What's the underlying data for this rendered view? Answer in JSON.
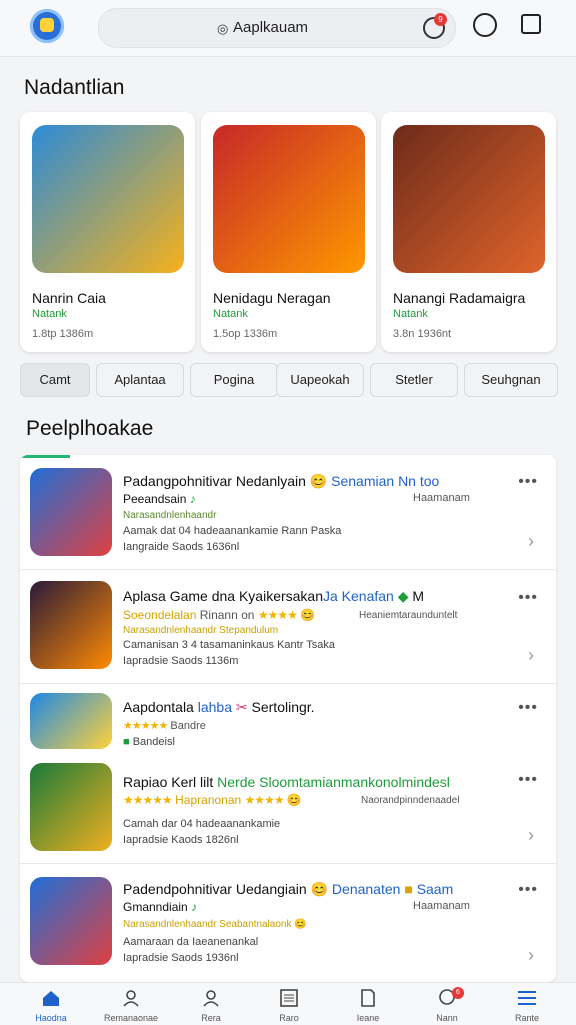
{
  "header": {
    "search_icon": "circle-dot-icon",
    "search_text": "Aaplkauam",
    "search_badge": "9"
  },
  "featured": {
    "title": "Nadantlian",
    "cards": [
      {
        "title": "Nanrin Caia",
        "sub": "Natank",
        "meta": "1.8tp 1386m",
        "colors": [
          "#2c8bd8",
          "#f7b11a"
        ]
      },
      {
        "title": "Nenidagu Neragan",
        "sub": "Natank",
        "meta": "1.5op 1336m",
        "colors": [
          "#c62828",
          "#ff9800"
        ]
      },
      {
        "title": "Nanangi Radamaigra",
        "sub": "Natank",
        "meta": "3.8n 1936nt",
        "colors": [
          "#6d2b1a",
          "#e0642b"
        ]
      }
    ]
  },
  "chips": [
    "Camt",
    "Aplantaa",
    "Pogina",
    "Uapeokah",
    "Stetler",
    "Seuhgnan"
  ],
  "popular": {
    "title": "Peelplhoakae",
    "rows": [
      {
        "title_a": "Padangpohnitivar Nedanlyain",
        "title_b": "Senamian Nn",
        "title_c": "too",
        "line2": "Peeandsain",
        "line2_right": "Haamanam",
        "line3": "Narasandnlenhaandr",
        "line4": "Aamak dat 04 hadeaanankamie Rann Paska",
        "line5": "Iangraide Saods 1636nl",
        "colors": [
          "#1f6fd6",
          "#e04040"
        ]
      },
      {
        "title_a": "Aplasa Game dna Kyaikersakan",
        "title_b": "Ja Kenafan",
        "title_c": "M",
        "line2": "Soeondelalan",
        "line2_mid": "Rinann on",
        "line2_right": "Heaniemtaraunduntelt",
        "line3": "Narasandnlenhaandr Stepandulum",
        "line4": "Camanisan 3 4 tasamaninkaus Kantr Tsaka",
        "line5": "Iapradsie Saods 1136m",
        "colors": [
          "#2a1a3a",
          "#ff8a00"
        ]
      },
      {
        "title_a": "Aapdontala",
        "title_b": "lahba",
        "title_c": "Sertolingr.",
        "line2": "★★★★★",
        "line2_right": "Bandre",
        "line3": "Bandeisl",
        "colors": [
          "#1e88e5",
          "#ffd23a"
        ]
      },
      {
        "title_a": "Rapiao Kerl lilt",
        "title_b": "Nerde Sloomtamianmankonolmindesl",
        "line2": "★★★★★",
        "line2_mid": "Hapranonan",
        "line2_right": "Naorandpinndenaadel",
        "line4": "Camah dar 04 hadeaanankamie",
        "line5": "Iapradsie Kaods 1826nl",
        "colors": [
          "#1a7a3a",
          "#f0b020"
        ]
      },
      {
        "title_a": "Padendpohnitivar Uedangiain",
        "title_b": "Denanaten",
        "title_c": "Saam",
        "line2": "Gmanndiain",
        "line2_right": "Haamanam",
        "line3": "Narasandnlenhaandr Seabantnalaonk",
        "line4": "Aamaraan da Iaeanenankal",
        "line5": "Iapradsie Saods 1936nl",
        "colors": [
          "#1f6fd6",
          "#e04040"
        ]
      }
    ]
  },
  "bottom_nav": [
    {
      "label": "Haodna",
      "icon": "home-icon",
      "active": true
    },
    {
      "label": "Remanaonae",
      "icon": "person-icon"
    },
    {
      "label": "Rera",
      "icon": "person-icon"
    },
    {
      "label": "Raro",
      "icon": "list-icon"
    },
    {
      "label": "Ieane",
      "icon": "document-icon"
    },
    {
      "label": "Nann",
      "icon": "chat-icon",
      "badge": "6"
    },
    {
      "label": "Rante",
      "icon": "menu-icon"
    }
  ]
}
